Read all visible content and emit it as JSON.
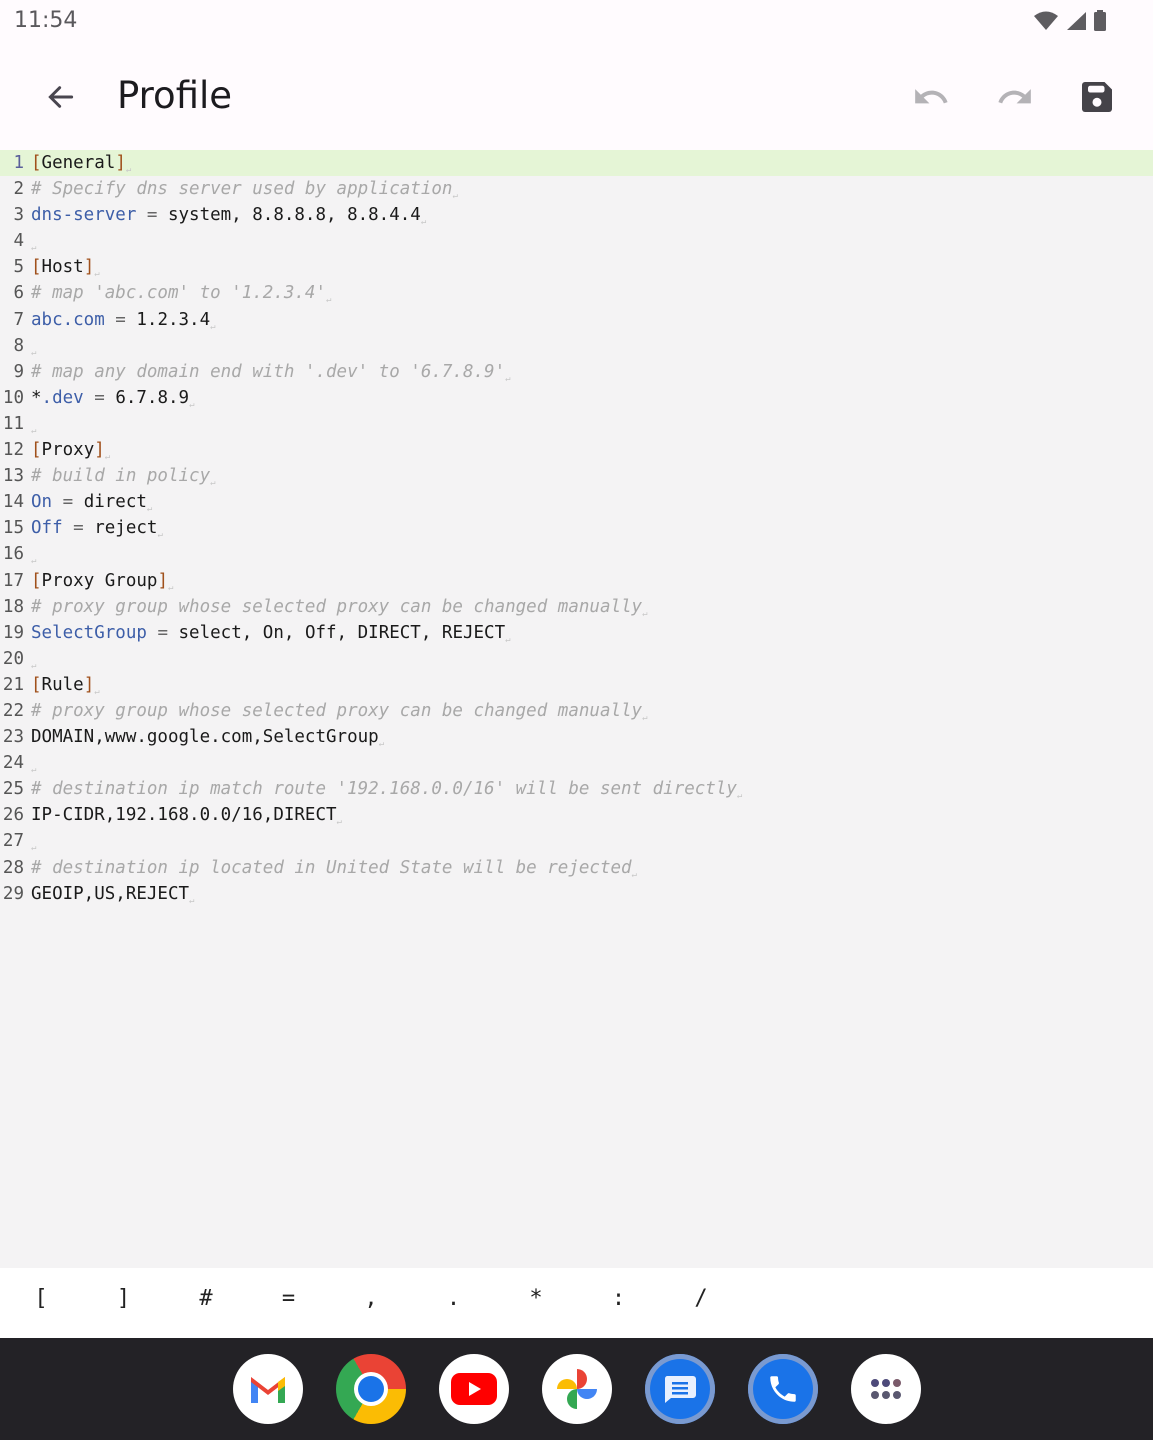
{
  "status_bar": {
    "time": "11:54",
    "icons": [
      "wifi-icon",
      "signal-icon",
      "battery-icon"
    ]
  },
  "app_bar": {
    "title": "Profile",
    "back_icon": "arrow-left-icon",
    "actions": [
      {
        "name": "undo",
        "icon": "undo-icon",
        "enabled": false
      },
      {
        "name": "redo",
        "icon": "redo-icon",
        "enabled": false
      },
      {
        "name": "save",
        "icon": "save-icon",
        "enabled": true
      }
    ]
  },
  "editor": {
    "active_line": 1,
    "lines": [
      {
        "n": "1",
        "tokens": [
          {
            "t": "br",
            "v": "["
          },
          {
            "t": "tx",
            "v": "General"
          },
          {
            "t": "br",
            "v": "]"
          }
        ]
      },
      {
        "n": "2",
        "tokens": [
          {
            "t": "cm",
            "v": "# Specify dns server used by application"
          }
        ]
      },
      {
        "n": "3",
        "tokens": [
          {
            "t": "key",
            "v": "dns-server"
          },
          {
            "t": "op",
            "v": " = "
          },
          {
            "t": "tx",
            "v": "system, 8.8.8.8, 8.8.4.4"
          }
        ]
      },
      {
        "n": "4",
        "tokens": []
      },
      {
        "n": "5",
        "tokens": [
          {
            "t": "br",
            "v": "["
          },
          {
            "t": "tx",
            "v": "Host"
          },
          {
            "t": "br",
            "v": "]"
          }
        ]
      },
      {
        "n": "6",
        "tokens": [
          {
            "t": "cm",
            "v": "# map 'abc.com' to '1.2.3.4'"
          }
        ]
      },
      {
        "n": "7",
        "tokens": [
          {
            "t": "key",
            "v": "abc.com"
          },
          {
            "t": "op",
            "v": " = "
          },
          {
            "t": "tx",
            "v": "1.2.3.4"
          }
        ]
      },
      {
        "n": "8",
        "tokens": []
      },
      {
        "n": "9",
        "tokens": [
          {
            "t": "cm",
            "v": "# map any domain end with '.dev' to '6.7.8.9'"
          }
        ]
      },
      {
        "n": "10",
        "tokens": [
          {
            "t": "tx",
            "v": "*"
          },
          {
            "t": "key",
            "v": ".dev"
          },
          {
            "t": "op",
            "v": " = "
          },
          {
            "t": "tx",
            "v": "6.7.8.9"
          }
        ]
      },
      {
        "n": "11",
        "tokens": []
      },
      {
        "n": "12",
        "tokens": [
          {
            "t": "br",
            "v": "["
          },
          {
            "t": "tx",
            "v": "Proxy"
          },
          {
            "t": "br",
            "v": "]"
          }
        ]
      },
      {
        "n": "13",
        "tokens": [
          {
            "t": "cm",
            "v": "# build in policy"
          }
        ]
      },
      {
        "n": "14",
        "tokens": [
          {
            "t": "key",
            "v": "On"
          },
          {
            "t": "op",
            "v": " = "
          },
          {
            "t": "tx",
            "v": "direct"
          }
        ]
      },
      {
        "n": "15",
        "tokens": [
          {
            "t": "key",
            "v": "Off"
          },
          {
            "t": "op",
            "v": " = "
          },
          {
            "t": "tx",
            "v": "reject"
          }
        ]
      },
      {
        "n": "16",
        "tokens": []
      },
      {
        "n": "17",
        "tokens": [
          {
            "t": "br",
            "v": "["
          },
          {
            "t": "tx",
            "v": "Proxy Group"
          },
          {
            "t": "br",
            "v": "]"
          }
        ]
      },
      {
        "n": "18",
        "tokens": [
          {
            "t": "cm",
            "v": "# proxy group whose selected proxy can be changed manually"
          }
        ]
      },
      {
        "n": "19",
        "tokens": [
          {
            "t": "key",
            "v": "SelectGroup"
          },
          {
            "t": "op",
            "v": " = "
          },
          {
            "t": "tx",
            "v": "select, On, Off, DIRECT, REJECT"
          }
        ]
      },
      {
        "n": "20",
        "tokens": []
      },
      {
        "n": "21",
        "tokens": [
          {
            "t": "br",
            "v": "["
          },
          {
            "t": "tx",
            "v": "Rule"
          },
          {
            "t": "br",
            "v": "]"
          }
        ]
      },
      {
        "n": "22",
        "tokens": [
          {
            "t": "cm",
            "v": "# proxy group whose selected proxy can be changed manually"
          }
        ]
      },
      {
        "n": "23",
        "tokens": [
          {
            "t": "tx",
            "v": "DOMAIN,www.google.com,SelectGroup"
          }
        ]
      },
      {
        "n": "24",
        "tokens": []
      },
      {
        "n": "25",
        "tokens": [
          {
            "t": "cm",
            "v": "# destination ip match route '192.168.0.0/16' will be sent directly"
          }
        ]
      },
      {
        "n": "26",
        "tokens": [
          {
            "t": "tx",
            "v": "IP-CIDR,192.168.0.0/16,DIRECT"
          }
        ]
      },
      {
        "n": "27",
        "tokens": []
      },
      {
        "n": "28",
        "tokens": [
          {
            "t": "cm",
            "v": "# destination ip located in United State will be rejected"
          }
        ]
      },
      {
        "n": "29",
        "tokens": [
          {
            "t": "tx",
            "v": "GEOIP,US,REJECT"
          }
        ]
      }
    ],
    "newline_marker": "↵"
  },
  "symbol_bar": {
    "symbols": [
      "[",
      "]",
      "#",
      "=",
      ",",
      ".",
      "*",
      ":",
      "/"
    ]
  },
  "dock": {
    "apps": [
      {
        "name": "gmail",
        "label": "Gmail"
      },
      {
        "name": "chrome",
        "label": "Chrome"
      },
      {
        "name": "youtube",
        "label": "YouTube"
      },
      {
        "name": "photos",
        "label": "Photos"
      },
      {
        "name": "messages",
        "label": "Messages"
      },
      {
        "name": "phone",
        "label": "Phone"
      },
      {
        "name": "app-drawer",
        "label": "All apps"
      }
    ]
  },
  "colors": {
    "active_line": "#e5f5d6",
    "bracket": "#a0501b",
    "key": "#3d5ea8",
    "comment": "#a8a8a8",
    "editor_bg": "#f4f3f4",
    "appbar_bg": "#fffbfe"
  }
}
